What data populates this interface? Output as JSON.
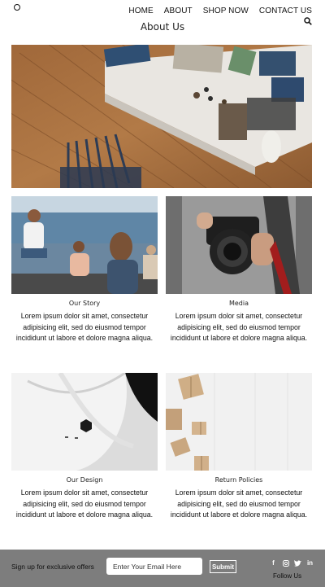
{
  "nav": {
    "items": [
      "HOME",
      "ABOUT",
      "SHOP NOW",
      "CONTACT US"
    ]
  },
  "page_title": "About Us",
  "cards": [
    {
      "title": "Our Story",
      "text": "Lorem ipsum dolor sit amet, consectetur adipisicing elit, sed do eiusmod tempor incididunt ut labore et dolore magna aliqua."
    },
    {
      "title": "Media",
      "text": "Lorem ipsum dolor sit amet, consectetur adipisicing elit, sed do eiusmod tempor incididunt ut labore et dolore magna aliqua."
    },
    {
      "title": "Our Design",
      "text": "Lorem ipsum dolor sit amet, consectetur adipisicing elit, sed do eiusmod tempor incididunt ut labore et dolore magna aliqua."
    },
    {
      "title": "Return Policies",
      "text": "Lorem ipsum dolor sit amet, consectetur adipisicing elit, sed do eiusmod tempor incididunt ut labore et dolore magna aliqua."
    }
  ],
  "footer": {
    "signup_text": "Sign up for exclusive offers",
    "email_placeholder": "Enter Your Email Here",
    "submit_label": "Submit",
    "follow_label": "Follow Us",
    "social_icons": [
      "facebook-icon",
      "instagram-icon",
      "twitter-icon",
      "linkedin-icon"
    ]
  },
  "colors": {
    "footer_bg": "#7d7d7d",
    "text": "#111111"
  }
}
